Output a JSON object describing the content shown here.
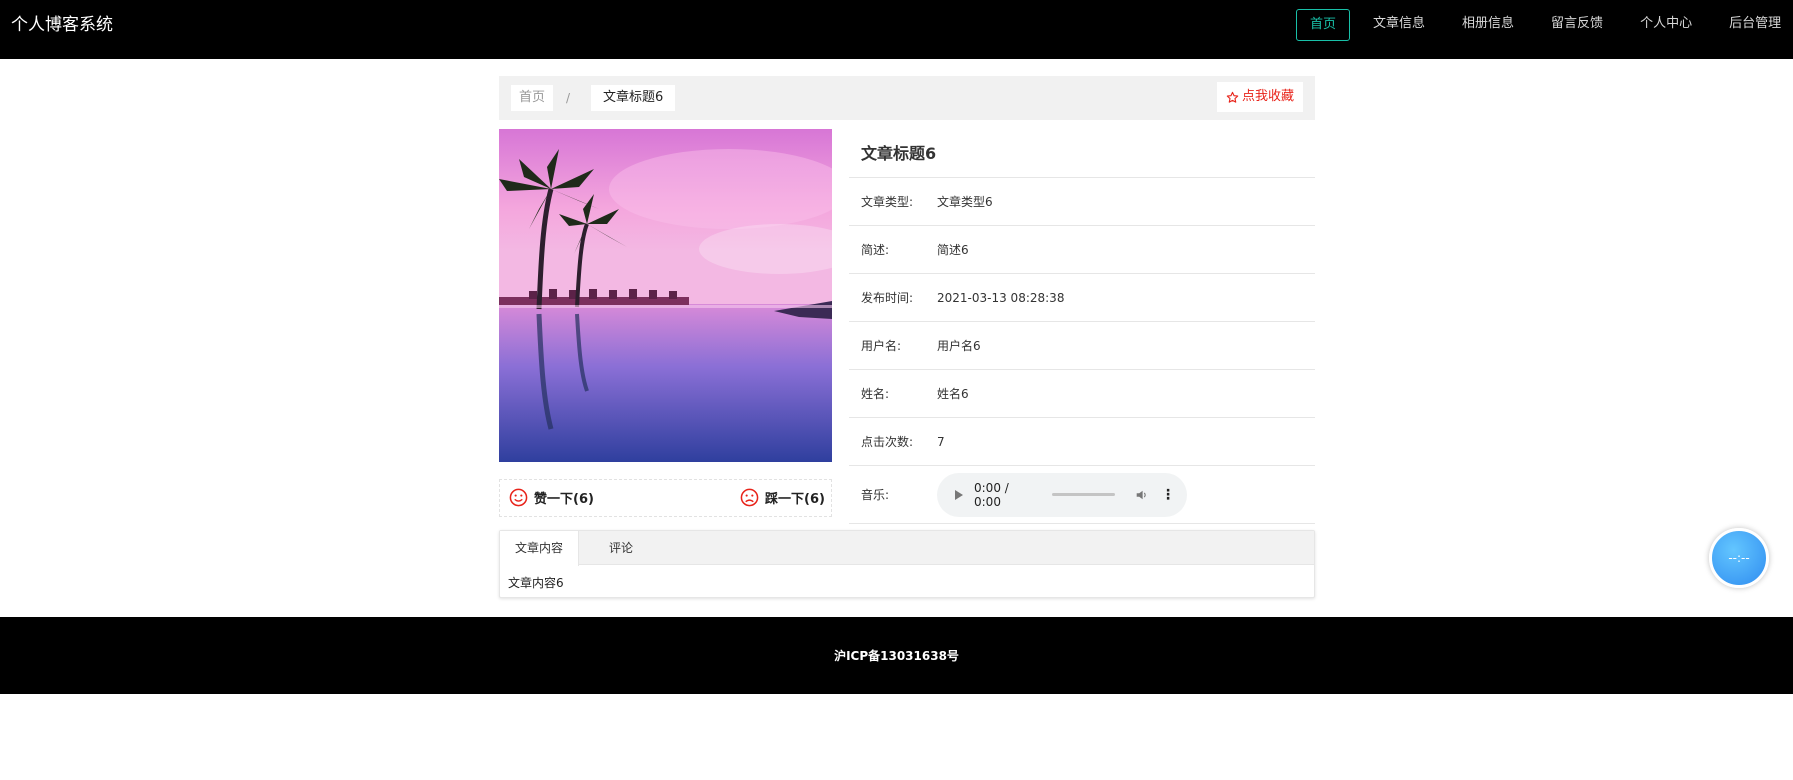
{
  "header": {
    "logo": "个人博客系统",
    "nav": [
      "首页",
      "文章信息",
      "相册信息",
      "留言反馈",
      "个人中心",
      "后台管理"
    ]
  },
  "breadcrumb": {
    "home": "首页",
    "separator": "/",
    "current": "文章标题6",
    "favorite": "点我收藏"
  },
  "votes": {
    "like": "赞一下(6)",
    "dislike": "踩一下(6)"
  },
  "article": {
    "title": "文章标题6",
    "fields": [
      {
        "label": "文章类型:",
        "value": "文章类型6"
      },
      {
        "label": "简述:",
        "value": "简述6"
      },
      {
        "label": "发布时间:",
        "value": "2021-03-13 08:28:38"
      },
      {
        "label": "用户名:",
        "value": "用户名6"
      },
      {
        "label": "姓名:",
        "value": "姓名6"
      },
      {
        "label": "点击次数:",
        "value": "7"
      }
    ],
    "music_label": "音乐:",
    "audio_time": "0:00 / 0:00"
  },
  "tabs": {
    "items": [
      "文章内容",
      "评论"
    ],
    "content": "文章内容6"
  },
  "footer": {
    "icp": "沪ICP备13031638号"
  },
  "float_player": {
    "time": "--:--"
  },
  "colors": {
    "accent": "#19c0a8",
    "favorite": "#e8231a",
    "vote_icon": "#e8231a",
    "player": "#2f8cf0"
  }
}
